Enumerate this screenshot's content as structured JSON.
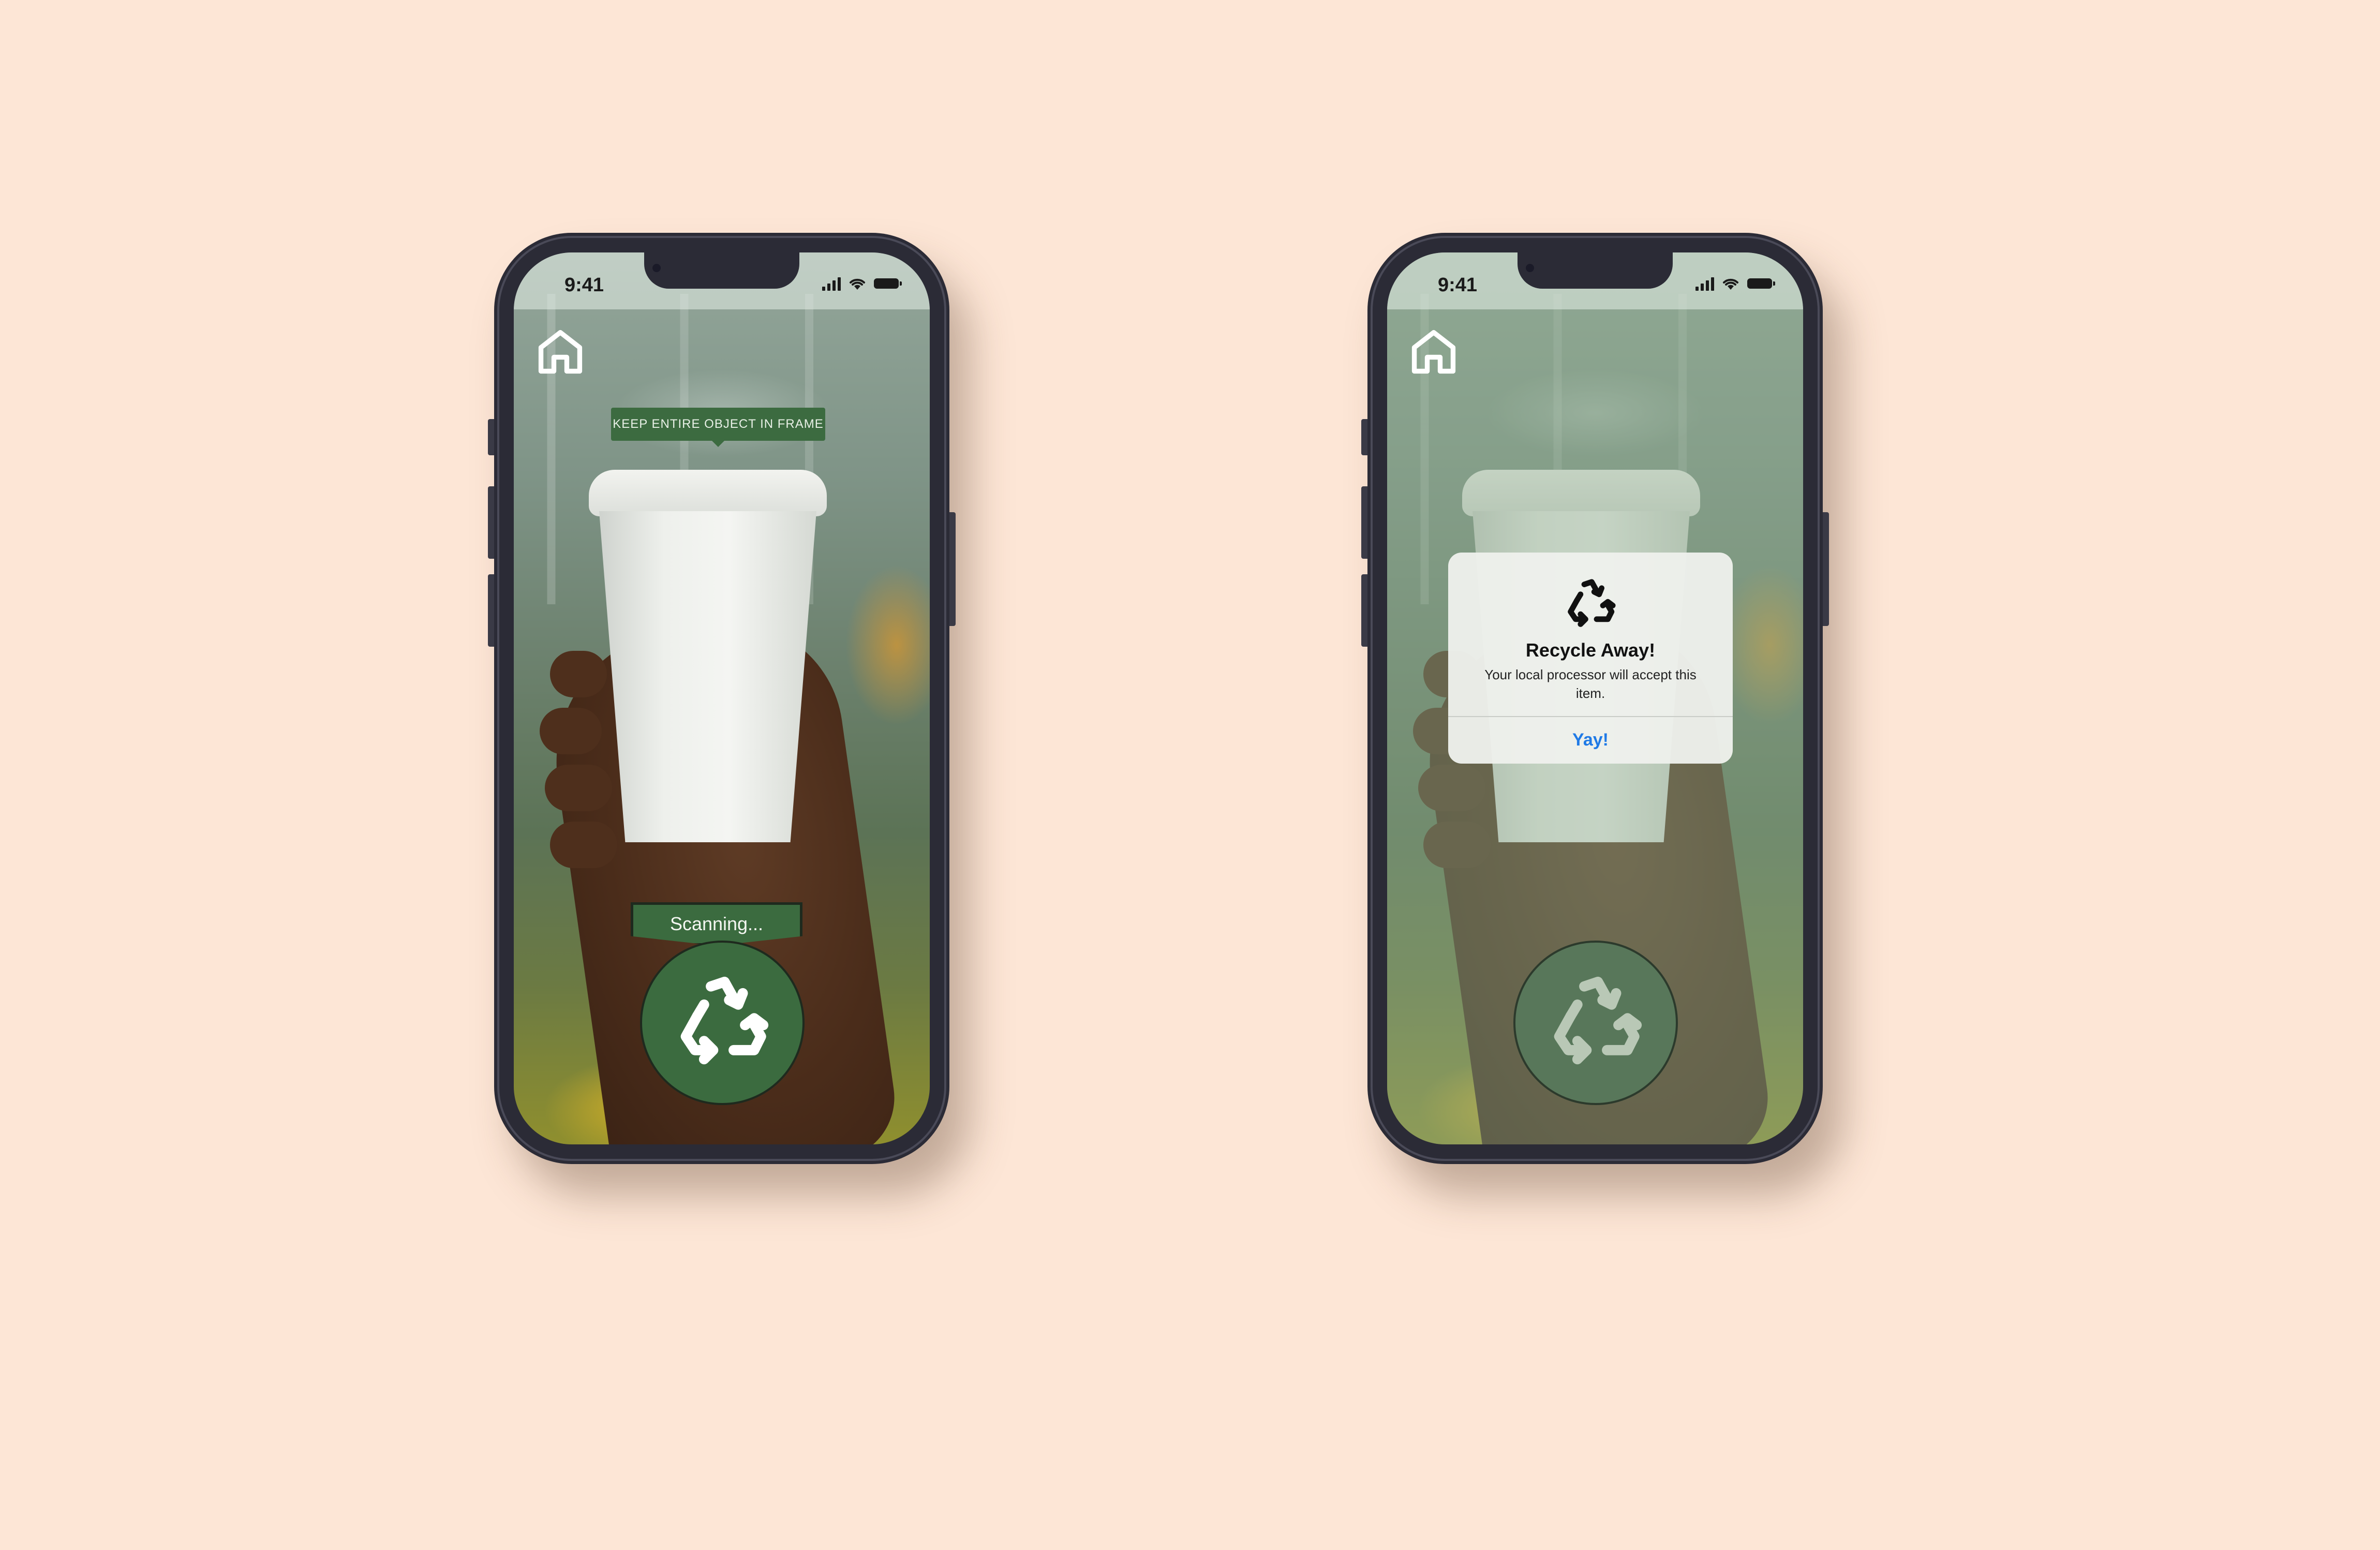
{
  "colors": {
    "background": "#fde6d6",
    "primary_green": "#3b6b3f",
    "alert_action": "#1f7ae6"
  },
  "screens": [
    {
      "status_bar": {
        "time": "9:41"
      },
      "home_icon": "home-icon",
      "hint": {
        "text": "KEEP ENTIRE OBJECT IN FRAME"
      },
      "scanning_label": "Scanning...",
      "scan_button_icon": "recycle-icon"
    },
    {
      "status_bar": {
        "time": "9:41"
      },
      "home_icon": "home-icon",
      "alert": {
        "icon": "recycle-icon",
        "title": "Recycle Away!",
        "message": "Your local processor will accept this item.",
        "button_label": "Yay!"
      },
      "scan_button_icon": "recycle-icon"
    }
  ]
}
